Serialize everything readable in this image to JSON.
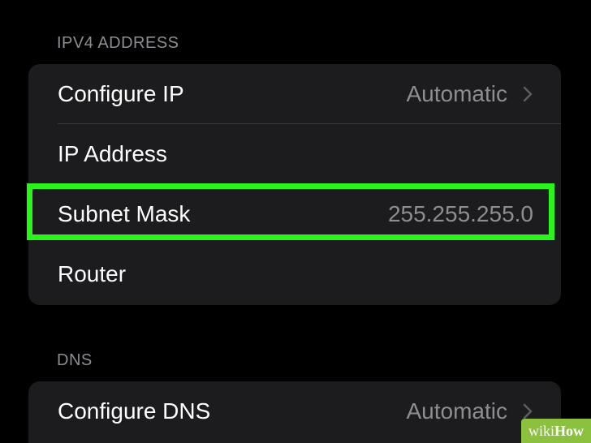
{
  "ipv4_section": {
    "header": "IPV4 ADDRESS",
    "rows": [
      {
        "label": "Configure IP",
        "value": "Automatic",
        "chevron": true
      },
      {
        "label": "IP Address",
        "value": ""
      },
      {
        "label": "Subnet Mask",
        "value": "255.255.255.0",
        "highlighted": true
      },
      {
        "label": "Router",
        "value": ""
      }
    ]
  },
  "dns_section": {
    "header": "DNS",
    "rows": [
      {
        "label": "Configure DNS",
        "value": "Automatic",
        "chevron": true
      }
    ]
  },
  "watermark": {
    "wiki": "wiki",
    "how": "How"
  },
  "colors": {
    "background": "#000000",
    "group_background": "#1c1c1e",
    "secondary_text": "#8d8d93",
    "separator": "#3a3a3c",
    "highlight_border": "#2af51a",
    "watermark_background": "#8bc13f"
  },
  "icons": {
    "chevron": "chevron-right-icon"
  }
}
